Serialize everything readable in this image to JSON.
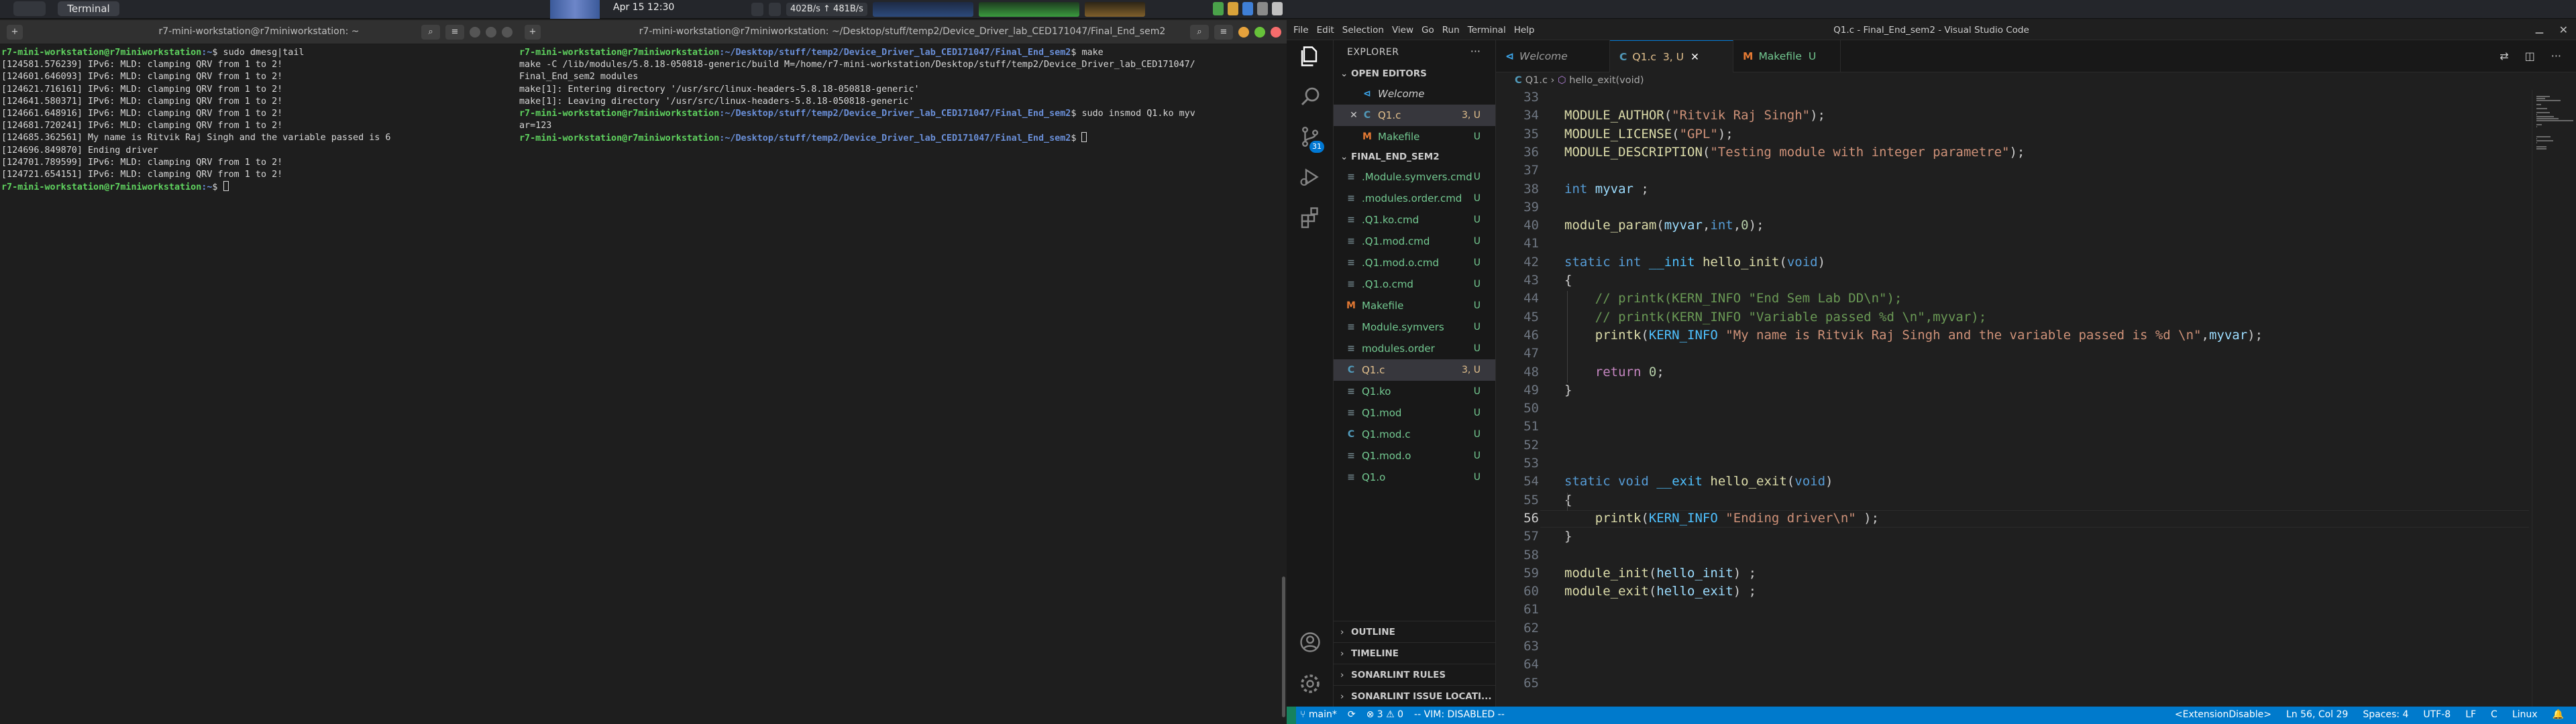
{
  "topbar": {
    "app_name": "Terminal",
    "clock": "Apr 15  12:30",
    "network": "402B/s ↑ 481B/s"
  },
  "terminal1": {
    "title": "r7-mini-workstation@r7miniworkstation: ~",
    "lines": [
      {
        "user": "r7-mini-workstation@r7miniworkstation",
        "path": ":~",
        "cmd": "$ sudo dmesg|tail"
      },
      {
        "text": "[124581.576239] IPv6: MLD: clamping QRV from 1 to 2!"
      },
      {
        "text": "[124601.646093] IPv6: MLD: clamping QRV from 1 to 2!"
      },
      {
        "text": "[124621.716161] IPv6: MLD: clamping QRV from 1 to 2!"
      },
      {
        "text": "[124641.580371] IPv6: MLD: clamping QRV from 1 to 2!"
      },
      {
        "text": "[124661.648916] IPv6: MLD: clamping QRV from 1 to 2!"
      },
      {
        "text": "[124681.720241] IPv6: MLD: clamping QRV from 1 to 2!"
      },
      {
        "text": "[124685.362561] My name is Ritvik Raj Singh and the variable passed is 6"
      },
      {
        "text": "[124696.849870] Ending driver"
      },
      {
        "text": "[124701.789599] IPv6: MLD: clamping QRV from 1 to 2!"
      },
      {
        "text": "[124721.654151] IPv6: MLD: clamping QRV from 1 to 2!"
      },
      {
        "user": "r7-mini-workstation@r7miniworkstation",
        "path": ":~",
        "cmd": "$ "
      }
    ]
  },
  "terminal2": {
    "title": "r7-mini-workstation@r7miniworkstation: ~/Desktop/stuff/temp2/Device_Driver_lab_CED171047/Final_End_sem2",
    "lines": [
      {
        "user": "r7-mini-workstation@r7miniworkstation",
        "path": ":~/Desktop/stuff/temp2/Device_Driver_lab_CED171047/Final_End_sem2",
        "cmd": "$ make"
      },
      {
        "text": "make -C /lib/modules/5.8.18-050818-generic/build M=/home/r7-mini-workstation/Desktop/stuff/temp2/Device_Driver_lab_CED171047/"
      },
      {
        "text": "Final_End_sem2 modules"
      },
      {
        "text": "make[1]: Entering directory '/usr/src/linux-headers-5.8.18-050818-generic'"
      },
      {
        "text": "make[1]: Leaving directory '/usr/src/linux-headers-5.8.18-050818-generic'"
      },
      {
        "user": "r7-mini-workstation@r7miniworkstation",
        "path": ":~/Desktop/stuff/temp2/Device_Driver_lab_CED171047/Final_End_sem2",
        "cmd": "$ sudo insmod Q1.ko myv"
      },
      {
        "text": "ar=123"
      },
      {
        "user": "r7-mini-workstation@r7miniworkstation",
        "path": ":~/Desktop/stuff/temp2/Device_Driver_lab_CED171047/Final_End_sem2",
        "cmd": "$ "
      }
    ]
  },
  "vscode": {
    "menu": [
      "File",
      "Edit",
      "Selection",
      "View",
      "Go",
      "Run",
      "Terminal",
      "Help"
    ],
    "window_title": "Q1.c - Final_End_sem2 - Visual Studio Code",
    "activity_badge": "31",
    "explorer_title": "EXPLORER",
    "open_editors_title": "OPEN EDITORS",
    "open_editors": [
      {
        "icon": "",
        "name": "Welcome",
        "status": "",
        "kind": "welcome"
      },
      {
        "icon": "C",
        "name": "Q1.c",
        "status": "3, U",
        "kind": "c",
        "close": "✕"
      },
      {
        "icon": "M",
        "name": "Makefile",
        "status": "U",
        "kind": "make"
      }
    ],
    "folder_title": "FINAL_END_SEM2",
    "files": [
      {
        "icon": "≡",
        "name": ".Module.symvers.cmd",
        "status": "U"
      },
      {
        "icon": "≡",
        "name": ".modules.order.cmd",
        "status": "U"
      },
      {
        "icon": "≡",
        "name": ".Q1.ko.cmd",
        "status": "U"
      },
      {
        "icon": "≡",
        "name": ".Q1.mod.cmd",
        "status": "U"
      },
      {
        "icon": "≡",
        "name": ".Q1.mod.o.cmd",
        "status": "U"
      },
      {
        "icon": "≡",
        "name": ".Q1.o.cmd",
        "status": "U"
      },
      {
        "icon": "M",
        "name": "Makefile",
        "status": "U"
      },
      {
        "icon": "≡",
        "name": "Module.symvers",
        "status": "U"
      },
      {
        "icon": "≡",
        "name": "modules.order",
        "status": "U"
      },
      {
        "icon": "C",
        "name": "Q1.c",
        "status": "3, U"
      },
      {
        "icon": "≡",
        "name": "Q1.ko",
        "status": "U"
      },
      {
        "icon": "≡",
        "name": "Q1.mod",
        "status": "U"
      },
      {
        "icon": "C",
        "name": "Q1.mod.c",
        "status": "U"
      },
      {
        "icon": "≡",
        "name": "Q1.mod.o",
        "status": "U"
      },
      {
        "icon": "≡",
        "name": "Q1.o",
        "status": "U"
      }
    ],
    "bottom_sections": [
      "OUTLINE",
      "TIMELINE",
      "SONARLINT RULES",
      "SONARLINT ISSUE LOCATI..."
    ],
    "tabs": [
      {
        "icon": "",
        "name": "Welcome",
        "status": ""
      },
      {
        "icon": "C",
        "name": "Q1.c",
        "status": "3, U",
        "close": "✕"
      },
      {
        "icon": "M",
        "name": "Makefile",
        "status": "U"
      }
    ],
    "breadcrumb": {
      "file": "Q1.c",
      "sep": "›",
      "symbol": "hello_exit(void)"
    },
    "code_lines": [
      {
        "n": "33",
        "tokens": []
      },
      {
        "n": "34",
        "tokens": [
          [
            "k-fn",
            "MODULE_AUTHOR"
          ],
          [
            "p",
            "("
          ],
          [
            "k-str",
            "\"Ritvik Raj Singh\""
          ],
          [
            "p",
            ");"
          ]
        ]
      },
      {
        "n": "35",
        "tokens": [
          [
            "k-fn",
            "MODULE_LICENSE"
          ],
          [
            "p",
            "("
          ],
          [
            "k-str",
            "\"GPL\""
          ],
          [
            "p",
            ");"
          ]
        ]
      },
      {
        "n": "36",
        "tokens": [
          [
            "k-fn",
            "MODULE_DESCRIPTION"
          ],
          [
            "p",
            "("
          ],
          [
            "k-str",
            "\"Testing module with integer parametre\""
          ],
          [
            "p",
            ");"
          ]
        ]
      },
      {
        "n": "37",
        "tokens": []
      },
      {
        "n": "38",
        "tokens": [
          [
            "k-type",
            "int"
          ],
          [
            "p",
            " "
          ],
          [
            "k-id",
            "myvar"
          ],
          [
            "p",
            " ;"
          ]
        ]
      },
      {
        "n": "39",
        "tokens": []
      },
      {
        "n": "40",
        "tokens": [
          [
            "k-fn",
            "module_param"
          ],
          [
            "p",
            "("
          ],
          [
            "k-id",
            "myvar"
          ],
          [
            "p",
            ","
          ],
          [
            "k-type",
            "int"
          ],
          [
            "p",
            ","
          ],
          [
            "k-num",
            "0"
          ],
          [
            "p",
            ");"
          ]
        ]
      },
      {
        "n": "41",
        "tokens": []
      },
      {
        "n": "42",
        "tokens": [
          [
            "k-kw",
            "static"
          ],
          [
            "p",
            " "
          ],
          [
            "k-type",
            "int"
          ],
          [
            "p",
            " "
          ],
          [
            "k-mac",
            "__init"
          ],
          [
            "p",
            " "
          ],
          [
            "k-fn",
            "hello_init"
          ],
          [
            "p",
            "("
          ],
          [
            "k-type",
            "void"
          ],
          [
            "p",
            ")"
          ]
        ]
      },
      {
        "n": "43",
        "tokens": [
          [
            "p",
            "{"
          ]
        ]
      },
      {
        "n": "44",
        "tokens": [
          [
            "p",
            "    "
          ],
          [
            "k-com",
            "// printk(KERN_INFO \"End Sem Lab DD\\n\");"
          ]
        ]
      },
      {
        "n": "45",
        "tokens": [
          [
            "p",
            "    "
          ],
          [
            "k-com",
            "// printk(KERN_INFO \"Variable passed %d \\n\",myvar);"
          ]
        ]
      },
      {
        "n": "46",
        "tokens": [
          [
            "p",
            "    "
          ],
          [
            "k-fn",
            "printk"
          ],
          [
            "p",
            "("
          ],
          [
            "k-mac",
            "KERN_INFO"
          ],
          [
            "p",
            " "
          ],
          [
            "k-str",
            "\"My name is Ritvik Raj Singh and the variable passed is %d \\n\""
          ],
          [
            "p",
            ","
          ],
          [
            "k-id",
            "myvar"
          ],
          [
            "p",
            ");"
          ]
        ]
      },
      {
        "n": "47",
        "tokens": []
      },
      {
        "n": "48",
        "tokens": [
          [
            "p",
            "    "
          ],
          [
            "k-ret",
            "return"
          ],
          [
            "p",
            " "
          ],
          [
            "k-num",
            "0"
          ],
          [
            "p",
            ";"
          ]
        ]
      },
      {
        "n": "49",
        "tokens": [
          [
            "p",
            "}"
          ]
        ]
      },
      {
        "n": "50",
        "tokens": []
      },
      {
        "n": "51",
        "tokens": []
      },
      {
        "n": "52",
        "tokens": []
      },
      {
        "n": "53",
        "tokens": []
      },
      {
        "n": "54",
        "tokens": [
          [
            "k-kw",
            "static"
          ],
          [
            "p",
            " "
          ],
          [
            "k-type",
            "void"
          ],
          [
            "p",
            " "
          ],
          [
            "k-mac",
            "__exit"
          ],
          [
            "p",
            " "
          ],
          [
            "k-fn",
            "hello_exit"
          ],
          [
            "p",
            "("
          ],
          [
            "k-type",
            "void"
          ],
          [
            "p",
            ")"
          ]
        ]
      },
      {
        "n": "55",
        "tokens": [
          [
            "p",
            "{"
          ]
        ]
      },
      {
        "n": "56",
        "tokens": [
          [
            "p",
            "    "
          ],
          [
            "k-fn",
            "printk"
          ],
          [
            "p",
            "("
          ],
          [
            "k-mac",
            "KERN_INFO"
          ],
          [
            "p",
            " "
          ],
          [
            "k-str",
            "\"Ending driver\\n\""
          ],
          [
            "p",
            " );"
          ]
        ],
        "current": true
      },
      {
        "n": "57",
        "tokens": [
          [
            "p",
            "}"
          ]
        ]
      },
      {
        "n": "58",
        "tokens": []
      },
      {
        "n": "59",
        "tokens": [
          [
            "k-fn",
            "module_init"
          ],
          [
            "p",
            "("
          ],
          [
            "k-id",
            "hello_init"
          ],
          [
            "p",
            ") ;"
          ]
        ]
      },
      {
        "n": "60",
        "tokens": [
          [
            "k-fn",
            "module_exit"
          ],
          [
            "p",
            "("
          ],
          [
            "k-id",
            "hello_exit"
          ],
          [
            "p",
            ") ;"
          ]
        ]
      },
      {
        "n": "61",
        "tokens": []
      },
      {
        "n": "62",
        "tokens": []
      },
      {
        "n": "63",
        "tokens": []
      },
      {
        "n": "64",
        "tokens": []
      },
      {
        "n": "65",
        "tokens": []
      }
    ],
    "status": {
      "branch": "main*",
      "sync": "⟳",
      "problems": "⊗ 3 ⚠ 0",
      "vim": "-- VIM: DISABLED --",
      "extension": "<ExtensionDisable>",
      "position": "Ln 56, Col 29",
      "spaces": "Spaces: 4",
      "encoding": "UTF-8",
      "eol": "LF",
      "language": "C",
      "os": "Linux",
      "bell": "🔔"
    }
  },
  "colors": {
    "accent": "#0078d4",
    "status_bar": "#007acc",
    "modified": "#e2c08d",
    "untracked": "#73c991"
  }
}
